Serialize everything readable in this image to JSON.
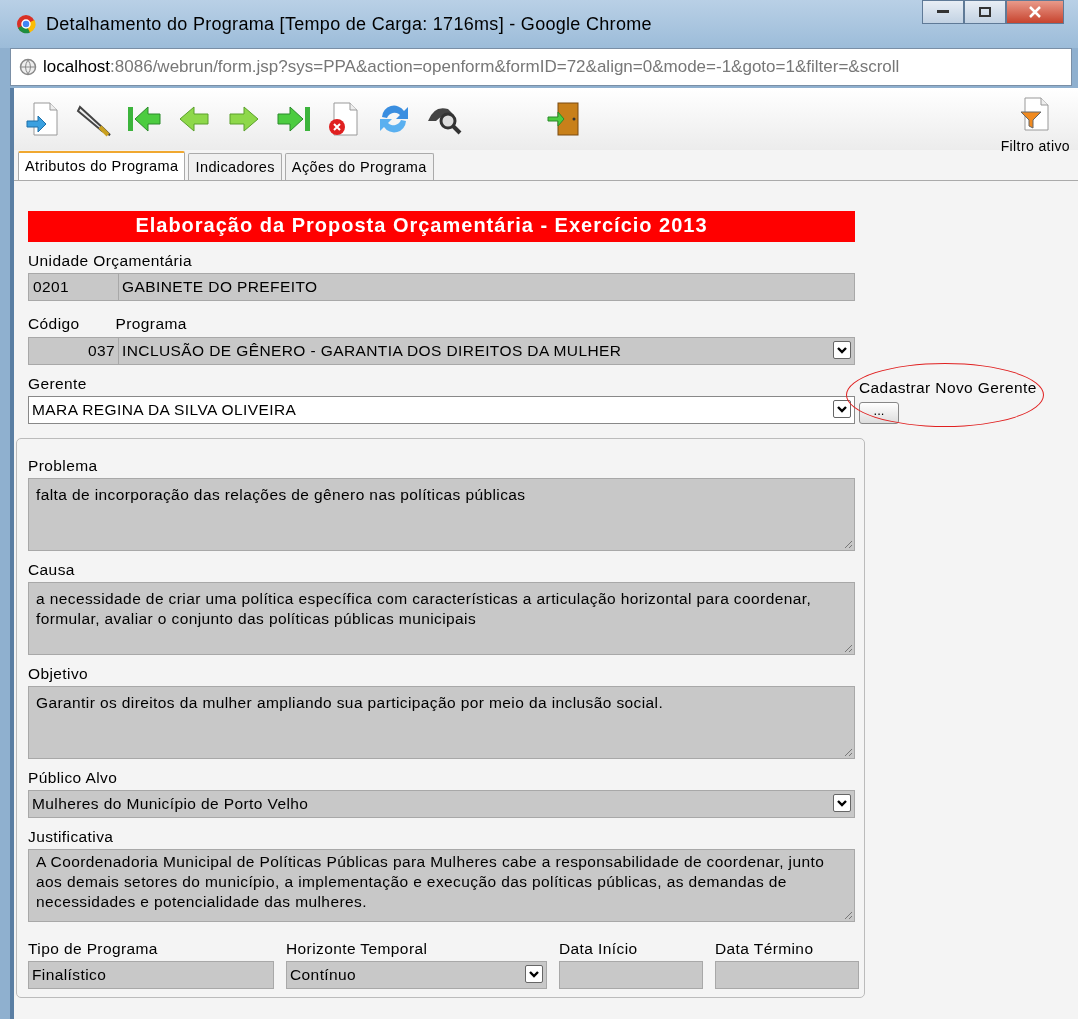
{
  "window": {
    "title": "Detalhamento do Programa [Tempo de Carga: 1716ms] - Google Chrome"
  },
  "address": {
    "host": "localhost",
    "rest": ":8086/webrun/form.jsp?sys=PPA&action=openform&formID=72&align=0&mode=-1&goto=1&filter=&scroll"
  },
  "toolbar": {
    "filter_label": "Filtro ativo"
  },
  "tabs": [
    {
      "label": "Atributos do Programa",
      "selected": true
    },
    {
      "label": "Indicadores",
      "selected": false
    },
    {
      "label": "Ações do Programa",
      "selected": false
    }
  ],
  "banner": "Elaboração da Proposta Orçamentária - Exercício 2013",
  "unidade": {
    "label": "Unidade Orçamentária",
    "code": "0201",
    "name": "GABINETE DO PREFEITO"
  },
  "programa": {
    "code_label": "Código",
    "label": "Programa",
    "code": "037",
    "value": "INCLUSÃO DE GÊNERO - GARANTIA DOS DIREITOS DA MULHER"
  },
  "gerente": {
    "label": "Gerente",
    "value": "MARA REGINA DA SILVA OLIVEIRA"
  },
  "new_manager": {
    "label": "Cadastrar Novo Gerente",
    "button": "..."
  },
  "details": [
    {
      "kind": "textarea",
      "label": "Problema",
      "value": "falta de incorporação das relações de gênero nas políticas públicas"
    },
    {
      "kind": "textarea",
      "label": "Causa",
      "value": "a necessidade de criar uma política específica com características a articulação horizontal para coordenar, formular, avaliar o conjunto das políticas públicas municipais"
    },
    {
      "kind": "textarea",
      "label": "Objetivo",
      "value": "Garantir os direitos da mulher ampliando sua participação por meio da inclusão social."
    },
    {
      "kind": "select",
      "label": "Público Alvo",
      "value": "Mulheres do Município de Porto Velho"
    },
    {
      "kind": "textarea_short",
      "label": "Justificativa",
      "value": "A Coordenadoria Municipal de Políticas Públicas para Mulheres cabe a responsabilidade de coordenar, junto aos demais setores do município, a implementação e execução das políticas públicas, as demandas de necessidades e potencialidade das mulheres."
    }
  ],
  "bottom_fields": [
    {
      "kind": "text",
      "label": "Tipo de Programa",
      "value": "Finalístico"
    },
    {
      "kind": "select",
      "label": "Horizonte Temporal",
      "value": "Contínuo"
    },
    {
      "kind": "text",
      "label": "Data Início"
    },
    {
      "kind": "text",
      "label": "Data Término"
    }
  ]
}
